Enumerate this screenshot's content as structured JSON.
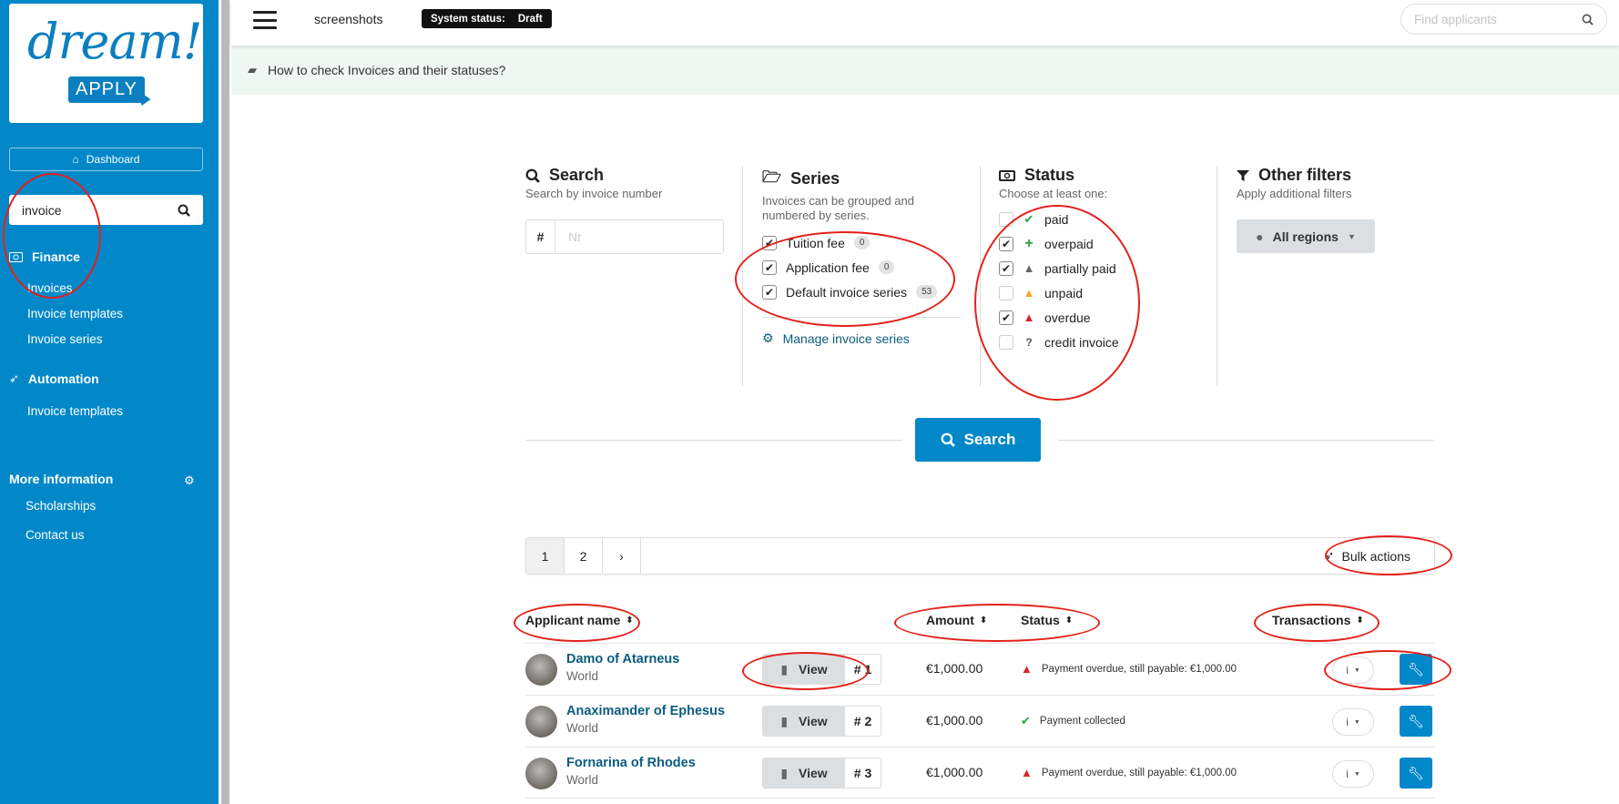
{
  "sidebar": {
    "logo_text": "dream!",
    "logo_button": "APPLY",
    "dashboard_label": "Dashboard",
    "search_value": "invoice",
    "sections": [
      {
        "label": "Finance",
        "icon": "money-icon",
        "items": [
          "Invoices",
          "Invoice templates",
          "Invoice series"
        ]
      },
      {
        "label": "Automation",
        "icon": "rocket-icon",
        "items": [
          "Invoice templates"
        ]
      },
      {
        "label": "More information",
        "icon": "gear-icon",
        "items": [
          "Scholarships",
          "Contact us"
        ]
      }
    ]
  },
  "topbar": {
    "site_name": "screenshots",
    "status_label": "System status:",
    "status_value": "Draft",
    "find_placeholder": "Find applicants"
  },
  "help": {
    "text": "How to check Invoices and their statuses?"
  },
  "filters": {
    "search": {
      "title": "Search",
      "subtitle": "Search by invoice number",
      "prefix": "#",
      "placeholder": "Nr"
    },
    "series": {
      "title": "Series",
      "subtitle": "Invoices can be grouped and numbered by series.",
      "items": [
        {
          "label": "Tuition fee",
          "count": "0",
          "checked": true
        },
        {
          "label": "Application fee",
          "count": "0",
          "checked": true
        },
        {
          "label": "Default invoice series",
          "count": "53",
          "checked": true
        }
      ],
      "manage_label": "Manage invoice series"
    },
    "status": {
      "title": "Status",
      "subtitle": "Choose at least one:",
      "items": [
        {
          "label": "paid",
          "checked": false,
          "icon": "check-icon",
          "color": "#22a546"
        },
        {
          "label": "overpaid",
          "checked": true,
          "icon": "plus-icon",
          "color": "#22a546"
        },
        {
          "label": "partially paid",
          "checked": true,
          "icon": "warning-icon",
          "color": "#666666"
        },
        {
          "label": "unpaid",
          "checked": false,
          "icon": "warning-icon",
          "color": "#f5a623"
        },
        {
          "label": "overdue",
          "checked": true,
          "icon": "warning-icon",
          "color": "#d9232e"
        },
        {
          "label": "credit invoice",
          "checked": false,
          "icon": "question-icon",
          "color": "#555555"
        }
      ]
    },
    "other": {
      "title": "Other filters",
      "subtitle": "Apply additional filters",
      "regions_label": "All regions"
    },
    "search_button": "Search"
  },
  "pagination": {
    "pages": [
      "1",
      "2"
    ],
    "current": "1",
    "next": "›",
    "bulk_actions": "Bulk actions"
  },
  "table": {
    "headers": {
      "applicant": "Applicant name",
      "amount": "Amount",
      "status": "Status",
      "transactions": "Transactions"
    },
    "view_label": "View",
    "rows": [
      {
        "name": "Damo of Atarneus",
        "region": "World",
        "number": "# 1",
        "amount": "€1,000.00",
        "status": "Payment overdue, still payable: €1,000.00",
        "status_type": "overdue"
      },
      {
        "name": "Anaximander of Ephesus",
        "region": "World",
        "number": "# 2",
        "amount": "€1,000.00",
        "status": "Payment collected",
        "status_type": "paid"
      },
      {
        "name": "Fornarina of Rhodes",
        "region": "World",
        "number": "# 3",
        "amount": "€1,000.00",
        "status": "Payment overdue, still payable: €1,000.00",
        "status_type": "overdue"
      }
    ]
  },
  "colors": {
    "brand": "#0288c9",
    "link": "#0b5c7e",
    "overdue": "#d9232e",
    "paid": "#22a546",
    "annotation": "#e3211b"
  }
}
